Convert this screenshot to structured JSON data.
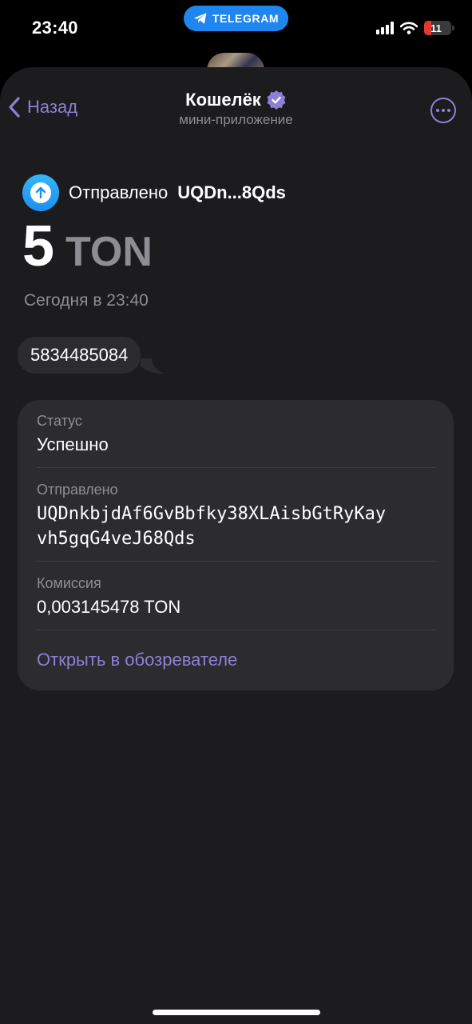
{
  "status_bar": {
    "time": "23:40",
    "pill_label": "TELEGRAM",
    "battery": "11",
    "battery_level_percent": 11,
    "icons": [
      "signal-icon",
      "wifi-icon",
      "battery-icon"
    ]
  },
  "nav": {
    "back_label": "Назад",
    "title": "Кошелёк",
    "subtitle": "мини-приложение",
    "verified_icon": "verified-badge-icon",
    "more_icon": "more-icon"
  },
  "transaction": {
    "sent_label": "Отправлено",
    "short_address": "UQDn...8Qds",
    "amount": "5",
    "currency": "TON",
    "date": "Сегодня в 23:40",
    "comment": "5834485084"
  },
  "details": {
    "status_label": "Статус",
    "status_value": "Успешно",
    "sent_label": "Отправлено",
    "address_line1": "UQDnkbjdAf6GvBbfky38XLAisbGtRyKay",
    "address_line2": "vh5gqG4veJ68Qds",
    "fee_label": "Комиссия",
    "fee_value": "0,003145478 TON",
    "open_link": "Открыть в обозревателе"
  },
  "colors": {
    "accent": "#8e7fd6",
    "background": "#1c1c1e",
    "card": "#2c2c2e",
    "secondary_text": "#8d8d93",
    "telegram_blue": "#1f86f0",
    "battery_red": "#e5392f"
  }
}
